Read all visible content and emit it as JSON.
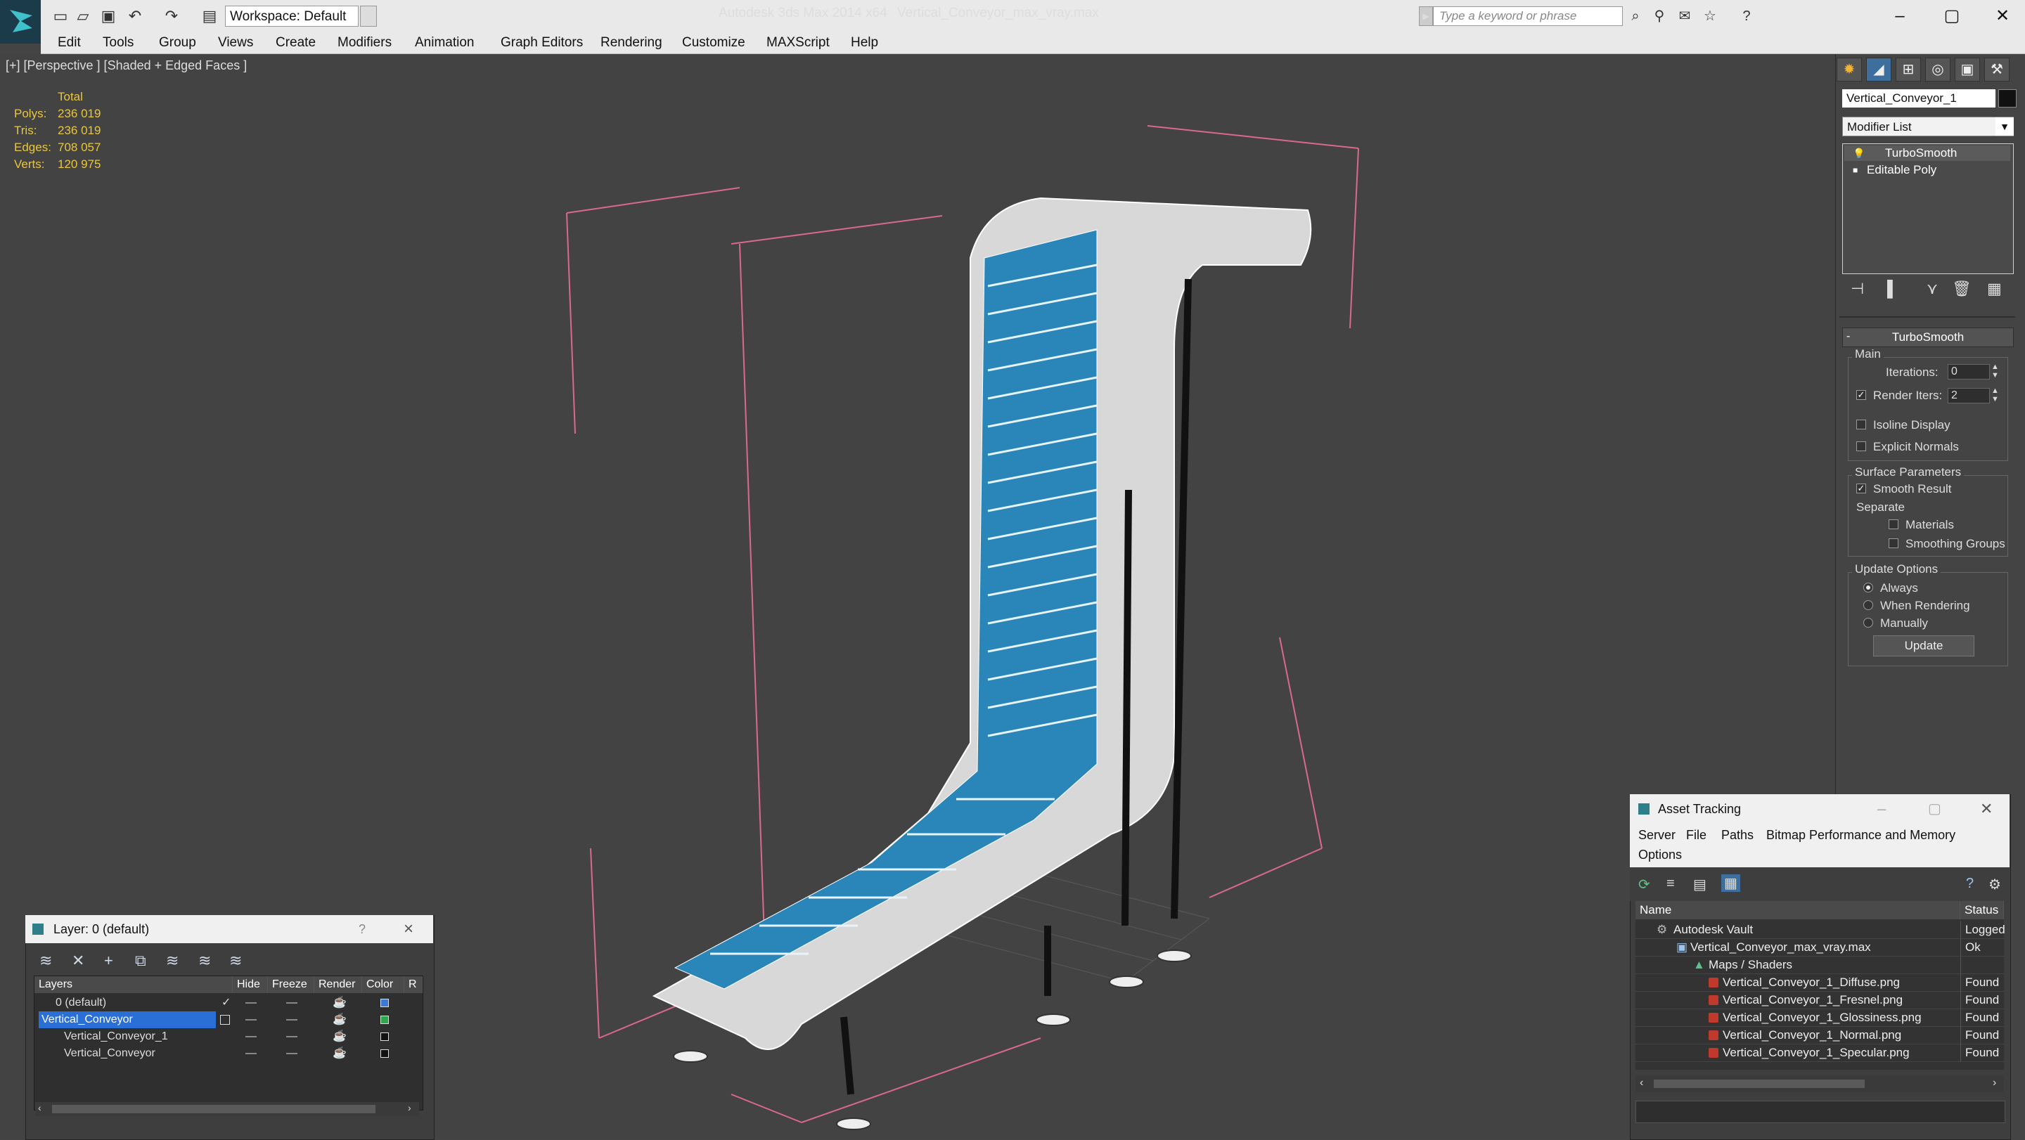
{
  "titlebar": {
    "workspace_label": "Workspace: Default",
    "app_name": "Autodesk 3ds Max  2014 x64",
    "file_name": "Vertical_Conveyor_max_vray.max",
    "search_placeholder": "Type a keyword or phrase"
  },
  "menu": [
    "Edit",
    "Tools",
    "Group",
    "Views",
    "Create",
    "Modifiers",
    "Animation",
    "Graph Editors",
    "Rendering",
    "Customize",
    "MAXScript",
    "Help"
  ],
  "viewport": {
    "label": "[+] [Perspective ] [Shaded + Edged Faces ]",
    "stats_header": "Total",
    "stats": [
      {
        "label": "Polys:",
        "value": "236 019"
      },
      {
        "label": "Tris:",
        "value": "236 019"
      },
      {
        "label": "Edges:",
        "value": "708 057"
      },
      {
        "label": "Verts:",
        "value": "120 975"
      }
    ]
  },
  "command_panel": {
    "object_name": "Vertical_Conveyor_1",
    "modifier_list": "Modifier List",
    "stack": [
      "TurboSmooth",
      "Editable Poly"
    ],
    "rollout": "TurboSmooth",
    "main": {
      "label": "Main",
      "iterations_label": "Iterations:",
      "iterations": "0",
      "render_iters_label": "Render Iters:",
      "render_iters": "2",
      "isoline": "Isoline Display",
      "explicit": "Explicit Normals"
    },
    "surface": {
      "label": "Surface Parameters",
      "smooth": "Smooth Result",
      "separate": "Separate",
      "materials": "Materials",
      "smoothing_groups": "Smoothing Groups"
    },
    "update": {
      "label": "Update Options",
      "always": "Always",
      "when_rendering": "When Rendering",
      "manually": "Manually",
      "button": "Update"
    }
  },
  "layer_dialog": {
    "title": "Layer: 0 (default)",
    "help": "?",
    "close": "×",
    "columns": [
      "Layers",
      "Hide",
      "Freeze",
      "Render",
      "Color",
      "R"
    ],
    "rows": [
      {
        "name": "0 (default)",
        "color": "#3a7bd5"
      },
      {
        "name": "Vertical_Conveyor",
        "color": "#2ea84a"
      },
      {
        "name": "Vertical_Conveyor_1",
        "color": "#111111"
      },
      {
        "name": "Vertical_Conveyor",
        "color": "#111111"
      }
    ]
  },
  "asset_dialog": {
    "title": "Asset Tracking",
    "menu": [
      "Server",
      "File",
      "Paths",
      "Bitmap Performance and Memory",
      "Options"
    ],
    "columns": [
      "Name",
      "Status"
    ],
    "rows": [
      {
        "name": "Autodesk Vault",
        "status": "Logged"
      },
      {
        "name": "Vertical_Conveyor_max_vray.max",
        "status": "Ok"
      },
      {
        "name": "Maps / Shaders",
        "status": ""
      },
      {
        "name": "Vertical_Conveyor_1_Diffuse.png",
        "status": "Found"
      },
      {
        "name": "Vertical_Conveyor_1_Fresnel.png",
        "status": "Found"
      },
      {
        "name": "Vertical_Conveyor_1_Glossiness.png",
        "status": "Found"
      },
      {
        "name": "Vertical_Conveyor_1_Normal.png",
        "status": "Found"
      },
      {
        "name": "Vertical_Conveyor_1_Specular.png",
        "status": "Found"
      }
    ]
  }
}
